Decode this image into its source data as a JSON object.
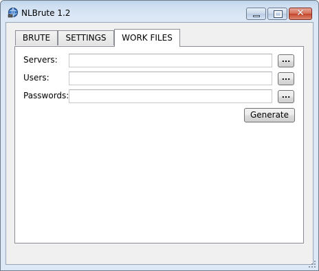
{
  "window": {
    "title": "NLBrute 1.2",
    "icon": "globe-app-icon",
    "controls": {
      "minimize": "minimize-icon",
      "maximize": "maximize-icon",
      "close_label": "✕"
    }
  },
  "tabs": [
    {
      "label": "BRUTE",
      "active": false
    },
    {
      "label": "SETTINGS",
      "active": false
    },
    {
      "label": "WORK FILES",
      "active": true
    }
  ],
  "work_files": {
    "servers": {
      "label": "Servers:",
      "value": "",
      "browse_label": "..."
    },
    "users": {
      "label": "Users:",
      "value": "",
      "browse_label": "..."
    },
    "passwords": {
      "label": "Passwords:",
      "value": "",
      "browse_label": "..."
    },
    "generate_label": "Generate"
  }
}
